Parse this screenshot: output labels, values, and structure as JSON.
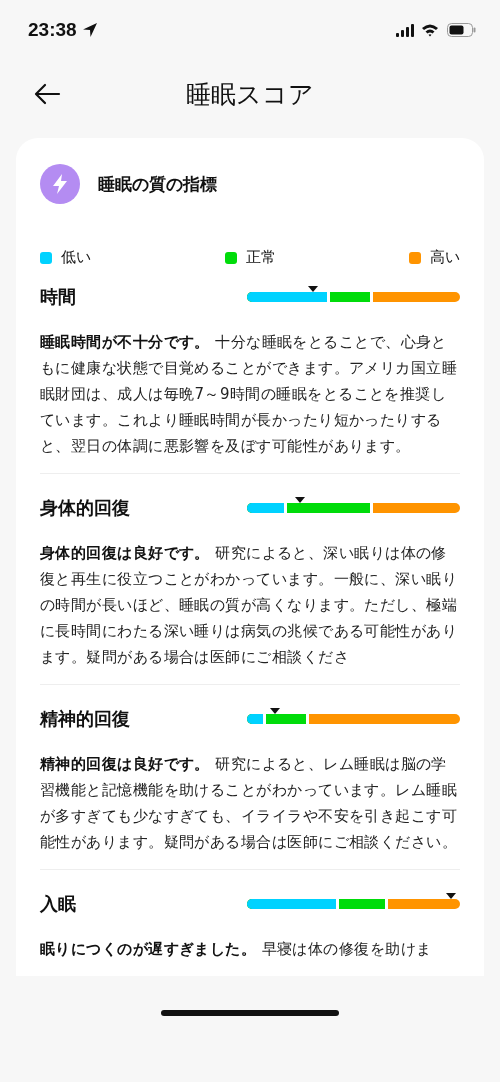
{
  "status_bar": {
    "time": "23:38"
  },
  "header": {
    "title": "睡眠スコア"
  },
  "card": {
    "title": "睡眠の質の指標",
    "legend": [
      {
        "label": "低い",
        "color": "#00d2ff"
      },
      {
        "label": "正常",
        "color": "#00dc0a"
      },
      {
        "label": "高い",
        "color": "#ff9400"
      }
    ],
    "metrics": [
      {
        "title": "時間",
        "level": 0.31,
        "bands": [
          {
            "level": 0.39
          },
          {
            "level": 0.59
          }
        ],
        "text": "**睡眠時間が不十分です。** 十分な睡眠をとることで、心身ともに健康な状態で目覚めることができます。アメリカ国立睡眠財団は、成人は毎晩7～9時間の睡眠をとることを推奨しています。これより睡眠時間が長かったり短かったりすると、翌日の体調に悪影響を及ぼす可能性があります。"
      },
      {
        "title": "身体的回復",
        "level": 0.25,
        "bands": [
          {
            "level": 0.19
          },
          {
            "level": 0.59
          }
        ],
        "text": "**身体的回復は良好です。** 研究によると、深い眠りは体の修復と再生に役立つことがわかっています。一般に、深い眠りの時間が長いほど、睡眠の質が高くなります。ただし、極端に長時間にわたる深い睡りは病気の兆候である可能性があります。疑問がある場合は医師にご相談くださ"
      },
      {
        "title": "精神的回復",
        "level": 0.13,
        "bands": [
          {
            "level": 0.09
          },
          {
            "level": 0.29
          }
        ],
        "text": "**精神的回復は良好です。** 研究によると、レム睡眠は脳の学習機能と記憶機能を助けることがわかっています。レム睡眠が多すぎても少なすぎても、イライラや不安を引き起こす可能性があります。疑問がある場合は医師にご相談ください。"
      },
      {
        "title": "入眠",
        "level": 0.96,
        "bands": [
          {
            "level": 0.43
          },
          {
            "level": 0.66
          }
        ],
        "text": "**眠りにつくのが遅すぎました。** 早寝は体の修復を助けま"
      }
    ]
  }
}
